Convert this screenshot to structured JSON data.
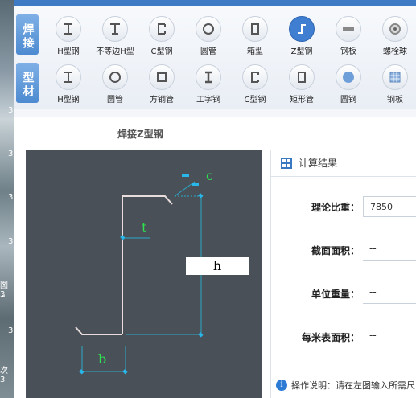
{
  "desktop": {
    "marks": [
      "3",
      "3",
      "3",
      "3",
      "图 3",
      "\"",
      "3",
      "次 3"
    ]
  },
  "toolbar": {
    "group1": "焊接",
    "group2": "型材",
    "row1": [
      {
        "label": "H型钢",
        "icon": "i-beam-icon"
      },
      {
        "label": "不等边H型",
        "icon": "unequal-i-beam-icon"
      },
      {
        "label": "C型钢",
        "icon": "c-channel-icon"
      },
      {
        "label": "圆管",
        "icon": "round-pipe-icon"
      },
      {
        "label": "箱型",
        "icon": "box-section-icon"
      },
      {
        "label": "Z型钢",
        "icon": "z-section-icon"
      },
      {
        "label": "钢板",
        "icon": "steel-plate-icon"
      },
      {
        "label": "螺栓球",
        "icon": "bolt-ball-icon"
      }
    ],
    "row2": [
      {
        "label": "H型钢",
        "icon": "i-beam-icon"
      },
      {
        "label": "圆管",
        "icon": "round-pipe-icon"
      },
      {
        "label": "方钢管",
        "icon": "square-pipe-icon"
      },
      {
        "label": "工字钢",
        "icon": "i-steel-icon"
      },
      {
        "label": "C型钢",
        "icon": "c-channel-icon"
      },
      {
        "label": "矩形管",
        "icon": "rect-pipe-icon"
      },
      {
        "label": "圆钢",
        "icon": "round-bar-icon"
      },
      {
        "label": "钢板",
        "icon": "steel-plate-icon"
      }
    ],
    "active_color": "#3f7ed1"
  },
  "section_title": "焊接Z型钢",
  "drawing": {
    "c": "c",
    "t": "t",
    "h": "h",
    "b": "b"
  },
  "result": {
    "title": "计算结果",
    "rows": [
      {
        "label": "理论比重：",
        "value": "7850"
      },
      {
        "label": "截面面积：",
        "value": "--"
      },
      {
        "label": "单位重量：",
        "value": "--"
      },
      {
        "label": "每米表面积：",
        "value": "--"
      }
    ],
    "note": "操作说明：请在左图输入所需尺"
  }
}
